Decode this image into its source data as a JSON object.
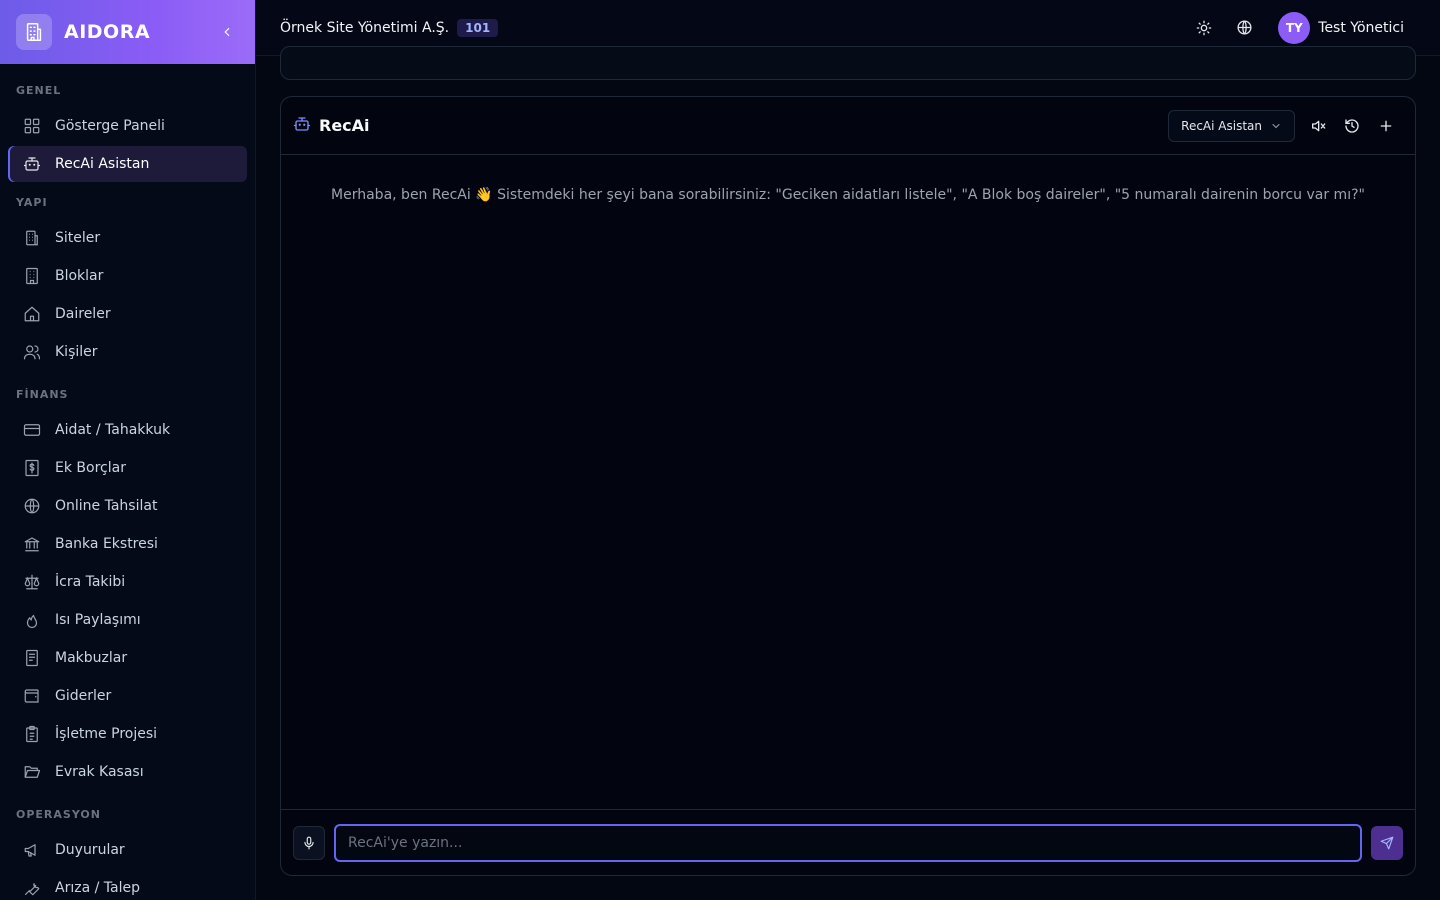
{
  "brand": {
    "name": "AIDORA"
  },
  "sidebar": {
    "sections": [
      {
        "title": "GENEL",
        "items": [
          {
            "label": "Gösterge Paneli",
            "icon": "dashboard-icon"
          },
          {
            "label": "RecAi Asistan",
            "icon": "bot-icon",
            "active": true
          }
        ]
      },
      {
        "title": "YAPI",
        "items": [
          {
            "label": "Siteler",
            "icon": "building-icon"
          },
          {
            "label": "Bloklar",
            "icon": "blocks-icon"
          },
          {
            "label": "Daireler",
            "icon": "home-icon"
          },
          {
            "label": "Kişiler",
            "icon": "users-icon"
          }
        ]
      },
      {
        "title": "FİNANS",
        "items": [
          {
            "label": "Aidat / Tahakkuk",
            "icon": "credit-card-icon"
          },
          {
            "label": "Ek Borçlar",
            "icon": "dollar-receipt-icon"
          },
          {
            "label": "Online Tahsilat",
            "icon": "globe-icon"
          },
          {
            "label": "Banka Ekstresi",
            "icon": "bank-icon"
          },
          {
            "label": "İcra Takibi",
            "icon": "scale-icon"
          },
          {
            "label": "Isı Paylaşımı",
            "icon": "flame-icon"
          },
          {
            "label": "Makbuzlar",
            "icon": "receipt-icon"
          },
          {
            "label": "Giderler",
            "icon": "wallet-icon"
          },
          {
            "label": "İşletme Projesi",
            "icon": "clipboard-icon"
          },
          {
            "label": "Evrak Kasası",
            "icon": "folder-open-icon"
          }
        ]
      },
      {
        "title": "OPERASYON",
        "items": [
          {
            "label": "Duyurular",
            "icon": "megaphone-icon"
          },
          {
            "label": "Arıza / Talep",
            "icon": "wrench-icon"
          }
        ]
      }
    ]
  },
  "topbar": {
    "org_name": "Örnek Site Yönetimi A.Ş.",
    "org_badge": "101",
    "user_initials": "TY",
    "user_name": "Test Yönetici"
  },
  "chat": {
    "title": "RecAi",
    "mode_label": "RecAi Asistan",
    "welcome": "Merhaba, ben RecAi 👋 Sistemdeki her şeyi bana sorabilirsiniz: \"Geciken aidatları listele\", \"A Blok boş daireler\", \"5 numaralı dairenin borcu var mı?\"",
    "input_placeholder": "RecAi'ye yazın..."
  },
  "colors": {
    "accent": "#6366f1",
    "brand_gradient_start": "#6d5ce8",
    "brand_gradient_end": "#9b6cf7"
  }
}
